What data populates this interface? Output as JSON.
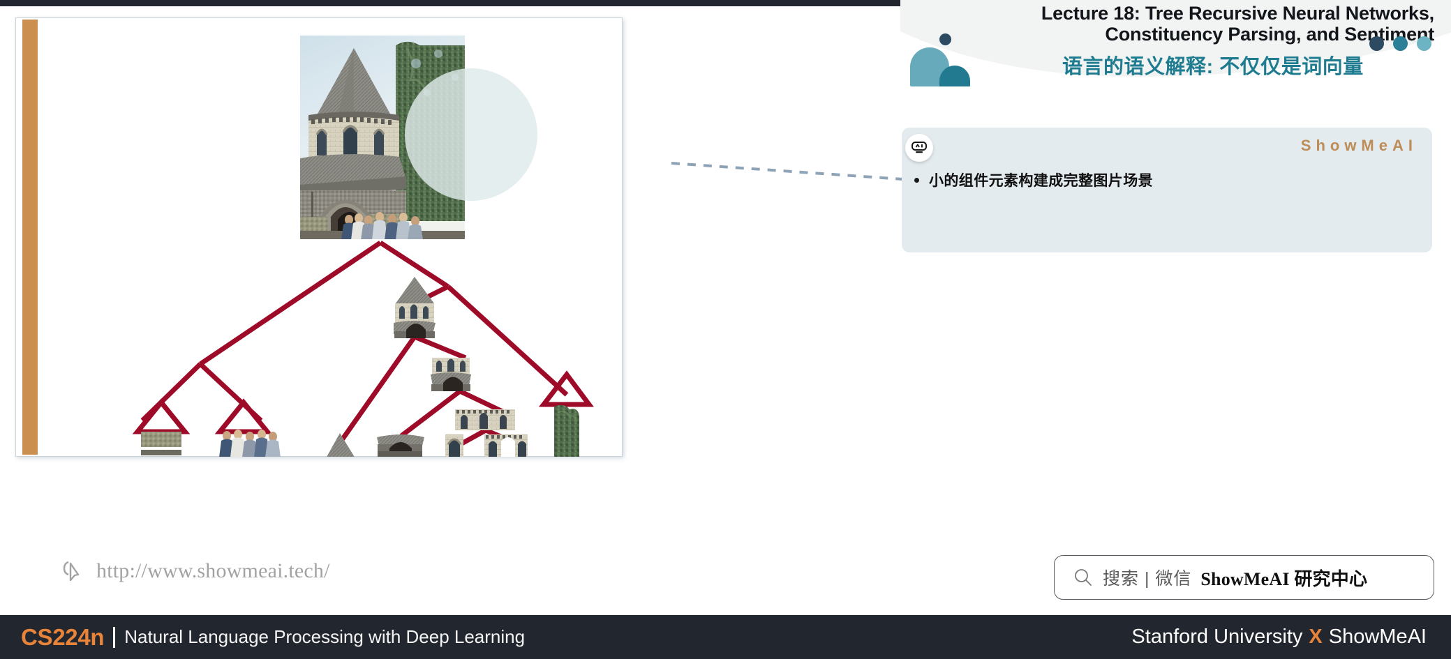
{
  "header": {
    "english_title_line1": "Lecture 18: Tree Recursive Neural Networks,",
    "english_title_line2": "Constituency Parsing, and Sentiment",
    "chinese_title": "语言的语义解释: 不仅仅是词向量",
    "dots": [
      {
        "name": "dot-navy",
        "color": "#2d4a63"
      },
      {
        "name": "dot-teal",
        "color": "#2b7f96"
      },
      {
        "name": "dot-light-teal",
        "color": "#6cb4c4"
      }
    ],
    "decor_colors": {
      "dome_big": "#67aabb",
      "dome_small": "#217a8f",
      "navy_dot": "#2d4a63",
      "curve_bg": "#f2f3f3"
    }
  },
  "callout": {
    "icon": "ai-robot-icon",
    "brand": "ShowMeAI",
    "brand_color": "#bd8c57",
    "bullets": [
      "小的组件元素构建成完整图片场景"
    ],
    "background": "#e3ebee"
  },
  "figure": {
    "caption": "Recursive parse tree over image regions of a round stone church",
    "tree_edge_color": "#9e0b28",
    "accent_circle_color": "#e3eeee",
    "watermark_url": "http://www.showmeai.tech/",
    "watermark_icon": "cursor-pointer-icon",
    "left_strip_color": "#cb8f50"
  },
  "search": {
    "icon": "search-icon",
    "label": "搜索 | 微信",
    "brand": "ShowMeAI 研究中心"
  },
  "footer": {
    "course_code": "CS224n",
    "course_name": "Natural Language Processing with Deep Learning",
    "right_left": "Stanford University",
    "right_x": "X",
    "right_right": "ShowMeAI",
    "background": "#22262e",
    "accent": "#e8833a"
  }
}
